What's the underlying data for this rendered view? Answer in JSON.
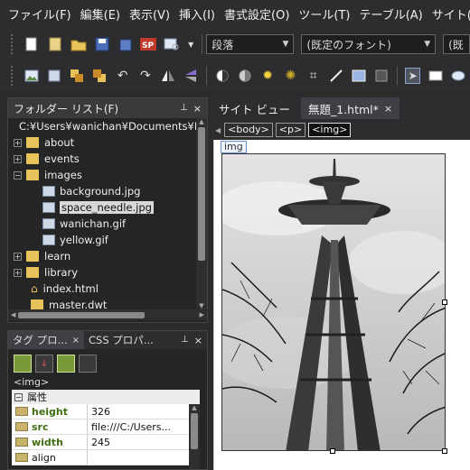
{
  "menubar": {
    "items": [
      "ファイル(F)",
      "編集(E)",
      "表示(V)",
      "挿入(I)",
      "書式設定(O)",
      "ツール(T)",
      "テーブル(A)",
      "サイト(S)"
    ]
  },
  "toolbar": {
    "paragraph_combo": "段落",
    "font_combo": "(既定のフォント)",
    "size_combo": "(既"
  },
  "folder_list": {
    "title": "フォルダー リスト(F)",
    "root": "C:¥Users¥wanichan¥Documents¥M",
    "items": [
      {
        "label": "about",
        "kind": "folder",
        "expander": "+"
      },
      {
        "label": "events",
        "kind": "folder",
        "expander": "+"
      },
      {
        "label": "images",
        "kind": "folder",
        "expander": "−"
      },
      {
        "label": "background.jpg",
        "kind": "file"
      },
      {
        "label": "space_needle.jpg",
        "kind": "file"
      },
      {
        "label": "wanichan.gif",
        "kind": "file"
      },
      {
        "label": "yellow.gif",
        "kind": "file"
      },
      {
        "label": "learn",
        "kind": "folder",
        "expander": "+"
      },
      {
        "label": "library",
        "kind": "folder",
        "expander": "+"
      },
      {
        "label": "index.html",
        "kind": "home"
      },
      {
        "label": "master.dwt",
        "kind": "folder"
      }
    ]
  },
  "tag_panel": {
    "tab1": "タグ プロ...",
    "tab2": "CSS プロパ...",
    "current_tag": "<img>",
    "section": "属性",
    "properties": [
      {
        "name": "height",
        "value": "326",
        "highlight": true
      },
      {
        "name": "src",
        "value": "file:///C:/Users...",
        "highlight": true
      },
      {
        "name": "width",
        "value": "245",
        "highlight": true
      },
      {
        "name": "align",
        "value": "",
        "highlight": false
      }
    ]
  },
  "editor": {
    "tab_site": "サイト ビュー",
    "tab_doc": "無題_1.html*",
    "quicktags": [
      "<body>",
      "<p>",
      "<img>"
    ],
    "img_label": "img"
  },
  "icons": {
    "pin": "pin-icon",
    "close": "close-icon",
    "expander": "expander-icon",
    "folder": "folder-icon",
    "file": "image-file-icon"
  },
  "colors": {
    "background": "#2b2b2b",
    "panel": "#252526",
    "accent_folder": "#e8c35a",
    "attr_green": "#3f6e12",
    "selected": "#d8d8d8"
  }
}
